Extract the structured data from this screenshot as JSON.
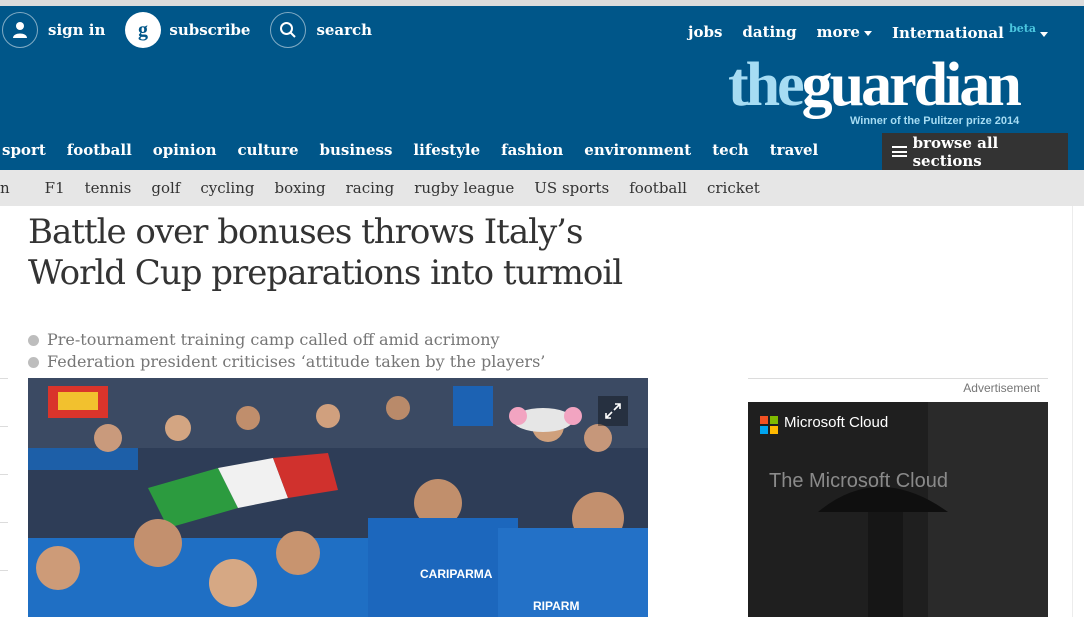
{
  "topbar": {
    "sign_in": "sign in",
    "subscribe": "subscribe",
    "search": "search",
    "jobs": "jobs",
    "dating": "dating",
    "more": "more",
    "edition": "International",
    "beta": "beta"
  },
  "logo": {
    "the": "the",
    "guardian": "guardian",
    "tagline": "Winner of the Pulitzer prize 2014"
  },
  "nav": {
    "items": [
      "sport",
      "football",
      "opinion",
      "culture",
      "business",
      "lifestyle",
      "fashion",
      "environment",
      "tech",
      "travel"
    ],
    "browse": "browse all sections"
  },
  "subnav": {
    "cut": "n",
    "items": [
      "F1",
      "tennis",
      "golf",
      "cycling",
      "boxing",
      "racing",
      "rugby league",
      "US sports",
      "football",
      "cricket"
    ]
  },
  "article": {
    "headline": "Battle over bonuses throws Italy’s World Cup preparations into turmoil",
    "standfirst": [
      "Pre-tournament training camp called off amid acrimony",
      "Federation president criticises ‘attitude taken by the players’"
    ]
  },
  "ad": {
    "label": "Advertisement",
    "brand": "Microsoft Cloud",
    "tagline": "The Microsoft Cloud"
  },
  "colors": {
    "brand_blue": "#005689",
    "logo_light": "#a6dcf3",
    "subnav_bg": "#e6e6e6",
    "browse_bg": "#333333"
  },
  "icons": [
    "user-icon",
    "subscribe-g-icon",
    "search-icon",
    "expand-icon",
    "menu-icon",
    "microsoft-logo-icon"
  ]
}
